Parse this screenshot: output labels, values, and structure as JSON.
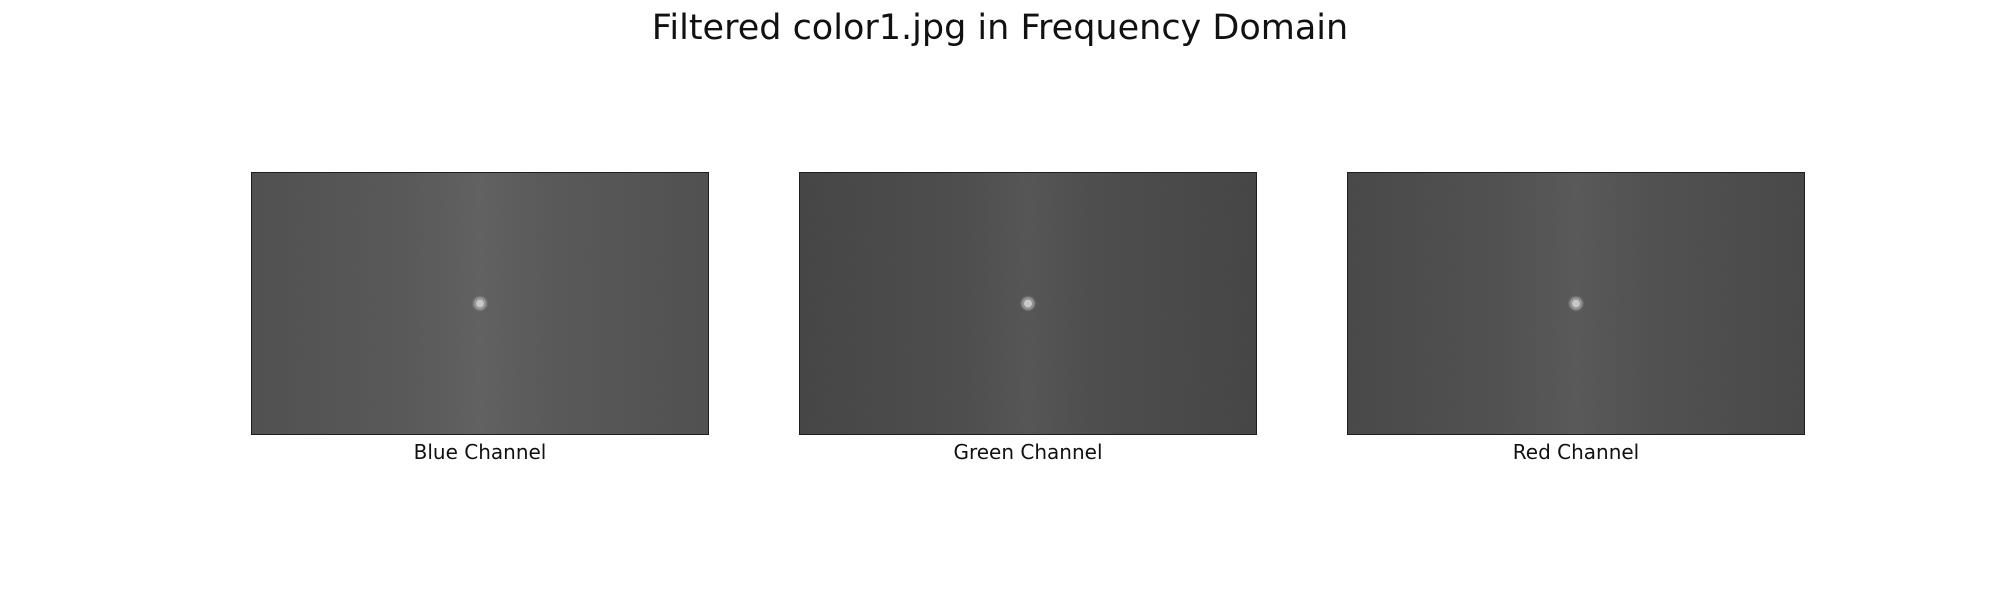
{
  "figure": {
    "title": "Filtered color1.jpg in Frequency Domain",
    "panels": [
      {
        "label": "Blue Channel",
        "colors": {
          "base": "#595959",
          "light": "#616161",
          "dark": "#505050",
          "peak": "#c8c8c8",
          "peak_edge": "#8a8a8a"
        }
      },
      {
        "label": "Green Channel",
        "colors": {
          "base": "#4d4d4d",
          "light": "#555555",
          "dark": "#454545",
          "peak": "#c9c9c9",
          "peak_edge": "#888888"
        }
      },
      {
        "label": "Red Channel",
        "colors": {
          "base": "#515151",
          "light": "#595959",
          "dark": "#484848",
          "peak": "#c8c8c8",
          "peak_edge": "#888888"
        }
      }
    ]
  }
}
